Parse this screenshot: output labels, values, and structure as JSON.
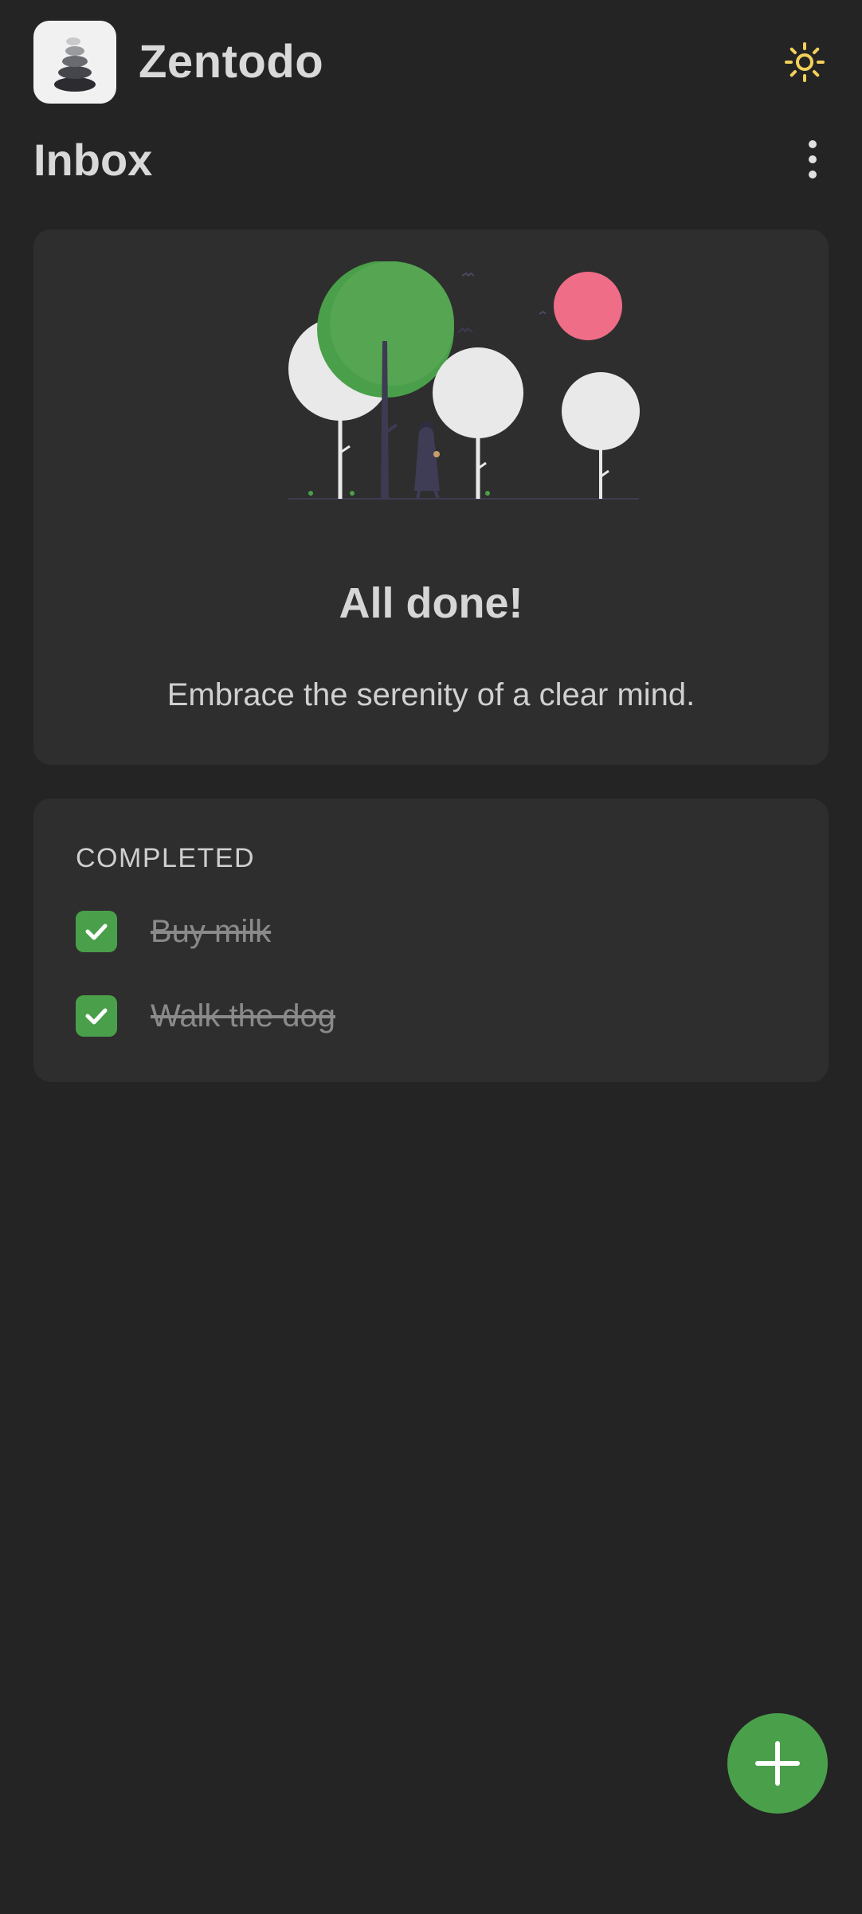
{
  "app": {
    "title": "Zentodo"
  },
  "page": {
    "title": "Inbox"
  },
  "empty_state": {
    "title": "All done!",
    "subtitle": "Embrace the serenity of a clear mind."
  },
  "completed": {
    "label": "COMPLETED",
    "tasks": [
      {
        "label": "Buy milk",
        "done": true
      },
      {
        "label": "Walk the dog",
        "done": true
      }
    ]
  },
  "icons": {
    "logo": "stacked-stones-icon",
    "theme": "sun-icon",
    "menu": "more-vertical-icon",
    "check": "check-icon",
    "add": "plus-icon"
  },
  "colors": {
    "background": "#242424",
    "card": "#2e2e2e",
    "accent": "#4aa04a",
    "sun": "#f2d15a",
    "balloon": "#ef6d87"
  }
}
